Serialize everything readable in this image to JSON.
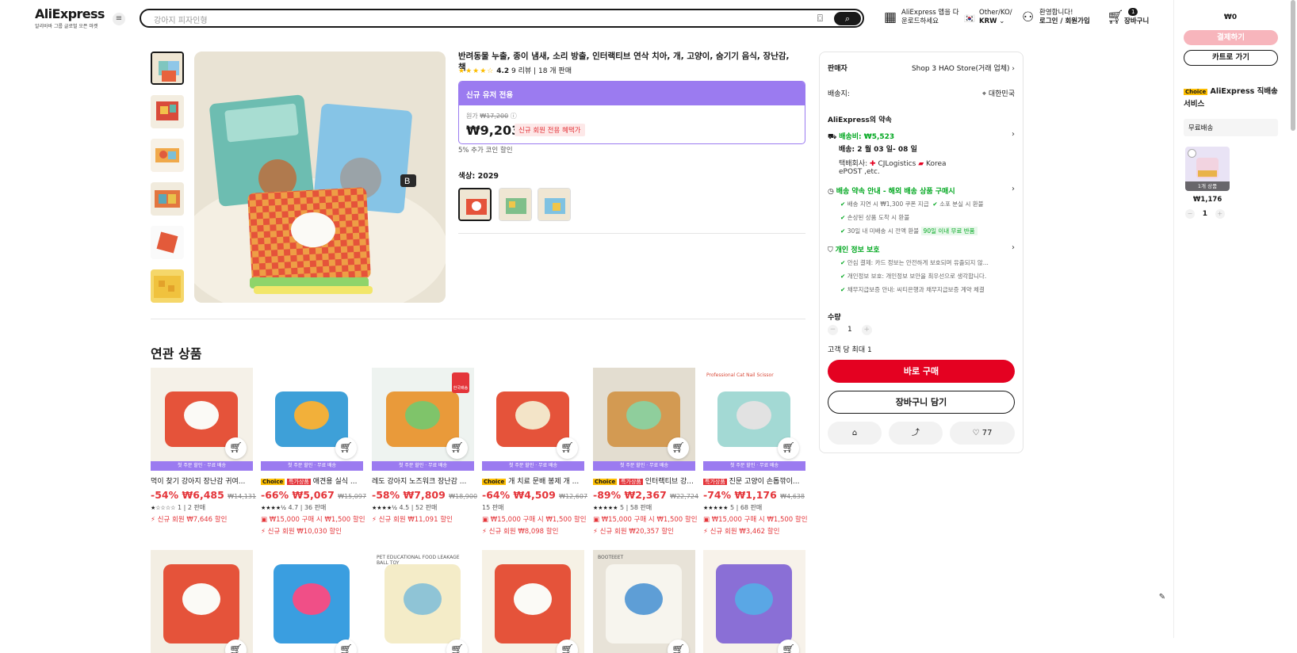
{
  "header": {
    "logo_main": "AliExpress",
    "logo_sub": "알리바바 그룹 글로벌 오픈 마켓",
    "menu_icon": "hamburger-icon",
    "search_placeholder": "강아지 피자인형",
    "app_line1": "AliExpress 앱을 다",
    "app_line2": "운로드하세요",
    "region_line1": "Other/KO/",
    "region_line2": "KRW",
    "account_line1": "환영합니다!",
    "account_line2": "로그인 / 회원가입",
    "cart_count": "1",
    "cart_label": "장바구니"
  },
  "product": {
    "title": "반려동물 누출, 종이 냄새, 소리 방출, 인터랙티브 연삭 치아, 개, 고양이, 숨기기 음식, 장난감, 책",
    "rating": "4.2",
    "reviews": "9 리뷰",
    "sold": "18 개 판매",
    "banner": "신규 유저 전용",
    "orig_label": "원가",
    "orig_price": "₩17,200",
    "price": "₩9,203",
    "price_tag": "신규 회원 전용 혜택가",
    "coupon": "5% 추가 코인 할인",
    "color_label": "색상:",
    "color_value": "2029"
  },
  "related": {
    "title": "연관 상품",
    "promo_label": "첫 주문 할인 · 무료 배송",
    "items": [
      {
        "name": "먹이 찾기 강아지 장난감 귀여...",
        "badge_choice": "",
        "badge_deal": "",
        "disc": "-54%",
        "price": "₩6,485",
        "orig": "₩14,131",
        "stars": "★☆☆☆☆",
        "rating": "1",
        "sold": "2 판매",
        "coupon1": "",
        "coupon2": "신규 회원 ₩7,646 할인"
      },
      {
        "name": "애견용 실식 ...",
        "badge_choice": "Choice",
        "badge_deal": "특가상품",
        "disc": "-66%",
        "price": "₩5,067",
        "orig": "₩15,097",
        "stars": "★★★★½",
        "rating": "4.7",
        "sold": "36 판매",
        "coupon1": "₩15,000 구매 시 ₩1,500 할인",
        "coupon2": "신규 회원 ₩10,030 할인"
      },
      {
        "name": "레도 강아지 노즈워크 장난감 ...",
        "badge_choice": "",
        "badge_deal": "",
        "disc": "-58%",
        "price": "₩7,809",
        "orig": "₩18,900",
        "stars": "★★★★½",
        "rating": "4.5",
        "sold": "52 판매",
        "coupon1": "",
        "coupon2": "신규 회원 ₩11,091 할인"
      },
      {
        "name": "개 치료 문배 봉제 개 ...",
        "badge_choice": "Choice",
        "badge_deal": "",
        "disc": "-64%",
        "price": "₩4,509",
        "orig": "₩12,607",
        "stars": "",
        "rating": "",
        "sold": "15 판매",
        "coupon1": "₩15,000 구매 시 ₩1,500 할인",
        "coupon2": "신규 회원 ₩8,098 할인"
      },
      {
        "name": "인터랙티브 강...",
        "badge_choice": "Choice",
        "badge_deal": "특가상품",
        "disc": "-89%",
        "price": "₩2,367",
        "orig": "₩22,724",
        "stars": "★★★★★",
        "rating": "5",
        "sold": "58 판매",
        "coupon1": "₩15,000 구매 시 ₩1,500 할인",
        "coupon2": "신규 회원 ₩20,357 할인"
      },
      {
        "name": "진문 고양이 손톱깎이...",
        "badge_choice": "",
        "badge_deal": "특가상품",
        "disc": "-74%",
        "price": "₩1,176",
        "orig": "₩4,638",
        "stars": "★★★★★",
        "rating": "5",
        "sold": "68 판매",
        "coupon1": "₩15,000 구매 시 ₩1,500 할인",
        "coupon2": "신규 회원 ₩3,462 할인"
      }
    ],
    "cart_icon": "add-to-cart-icon",
    "thumb_overlay": "Professional Cat Nail Scissor",
    "row2_labels": [
      "",
      "",
      "PET EDUCATIONAL FOOD LEAKAGE BALL TOY",
      "",
      "BOOTEEET",
      ""
    ],
    "flag_badge": "한국배송"
  },
  "seller": {
    "label": "판매자",
    "store": "Shop 3 HAO Store(거래 업체)",
    "ship_to_label": "배송지:",
    "ship_to": "대한민국",
    "promise": "AliExpress의 약속",
    "shipping_fee": "배송비: ₩5,523",
    "delivery": "배송: 2 월 03 일- 08 일",
    "carrier_prefix": "택배회사:",
    "carrier1": "CJLogistics",
    "carrier2": "Korea",
    "carrier3": "ePOST ,etc.",
    "guarantee_title": "배송 약속 안내 - 해외 배송 상품 구매시",
    "g1": "배송 지연 시 ₩1,300 쿠폰 지급",
    "g2": "소포 분실 시 환불",
    "g3": "손상된 상품 도착 시 환불",
    "g4": "30일 내 미배송 시 전액 환불",
    "g4_badge": "90일 이내 무료 반품",
    "privacy_title": "개인 정보 보호",
    "p1": "안심 결제: 카드 정보는 안전하게 보호되며 유출되지 않...",
    "p2": "개인정보 보호: 개인정보 보안을 최우선으로 생각합니다.",
    "p3": "채무지급보증 안내: 씨티은행과 채무지급보증 계약 체결",
    "qty_label": "수량",
    "qty": "1",
    "limit": "고객 당 최대 1",
    "buy_now": "바로 구매",
    "add_cart": "장바구니 담기",
    "wishlist_count": "77"
  },
  "mini_cart": {
    "total": "₩0",
    "pay": "결제하기",
    "go_cart": "카트로 가기",
    "choice": "Choice",
    "service": "AliExpress 직배송 서비스",
    "free": "무료배송",
    "item_qty_label": "1개 상품",
    "item_price": "₩1,176",
    "item_qty": "1"
  },
  "colors": {
    "accent_red": "#e40121",
    "promo_purple": "#9b7bf0",
    "green": "#00a71f",
    "star": "#fcbd01"
  }
}
